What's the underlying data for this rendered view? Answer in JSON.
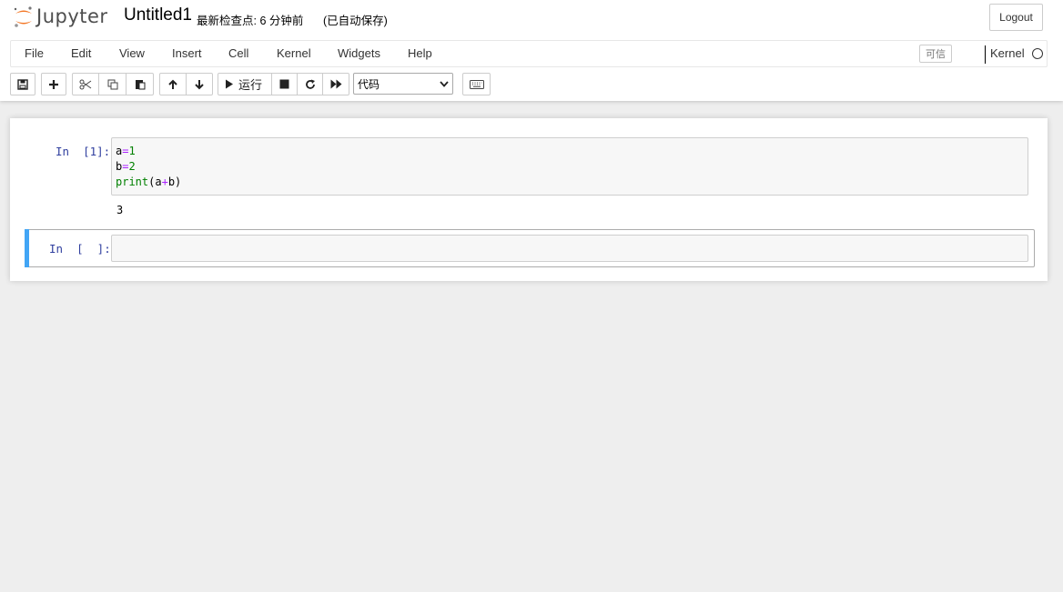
{
  "header": {
    "logo_text": "Jupyter",
    "notebook_title": "Untitled1",
    "checkpoint": "最新检查点: 6 分钟前",
    "autosave": "(已自动保存)",
    "logout_label": "Logout"
  },
  "menubar": {
    "items": [
      "File",
      "Edit",
      "View",
      "Insert",
      "Cell",
      "Kernel",
      "Widgets",
      "Help"
    ],
    "trusted_label": "可信",
    "kernel_label": "Kernel"
  },
  "toolbar": {
    "run_label": "运行",
    "cell_type": "代码",
    "cell_type_options": [
      "代码"
    ],
    "icons": [
      "save-icon",
      "plus-icon",
      "cut-icon",
      "copy-icon",
      "paste-icon",
      "arrow-up-icon",
      "arrow-down-icon",
      "play-icon",
      "stop-icon",
      "restart-icon",
      "fast-forward-icon",
      "keyboard-icon"
    ]
  },
  "cells": [
    {
      "prompt": "In  [1]:",
      "code": [
        [
          {
            "t": "a",
            "c": "var"
          },
          {
            "t": "=",
            "c": "op"
          },
          {
            "t": "1",
            "c": "num"
          }
        ],
        [
          {
            "t": "b",
            "c": "var"
          },
          {
            "t": "=",
            "c": "op"
          },
          {
            "t": "2",
            "c": "num"
          }
        ],
        [
          {
            "t": "print",
            "c": "builtin"
          },
          {
            "t": "(a",
            "c": "var"
          },
          {
            "t": "+",
            "c": "op"
          },
          {
            "t": "b)",
            "c": "var"
          }
        ]
      ],
      "output": "3"
    },
    {
      "prompt": "In  [  ]:",
      "code": [],
      "output": ""
    }
  ],
  "colors": {
    "prompt": "#303f9f",
    "selected_cell_bar": "#42a5f5",
    "keyword_green": "#008000",
    "operator_purple": "#aa22ff"
  }
}
